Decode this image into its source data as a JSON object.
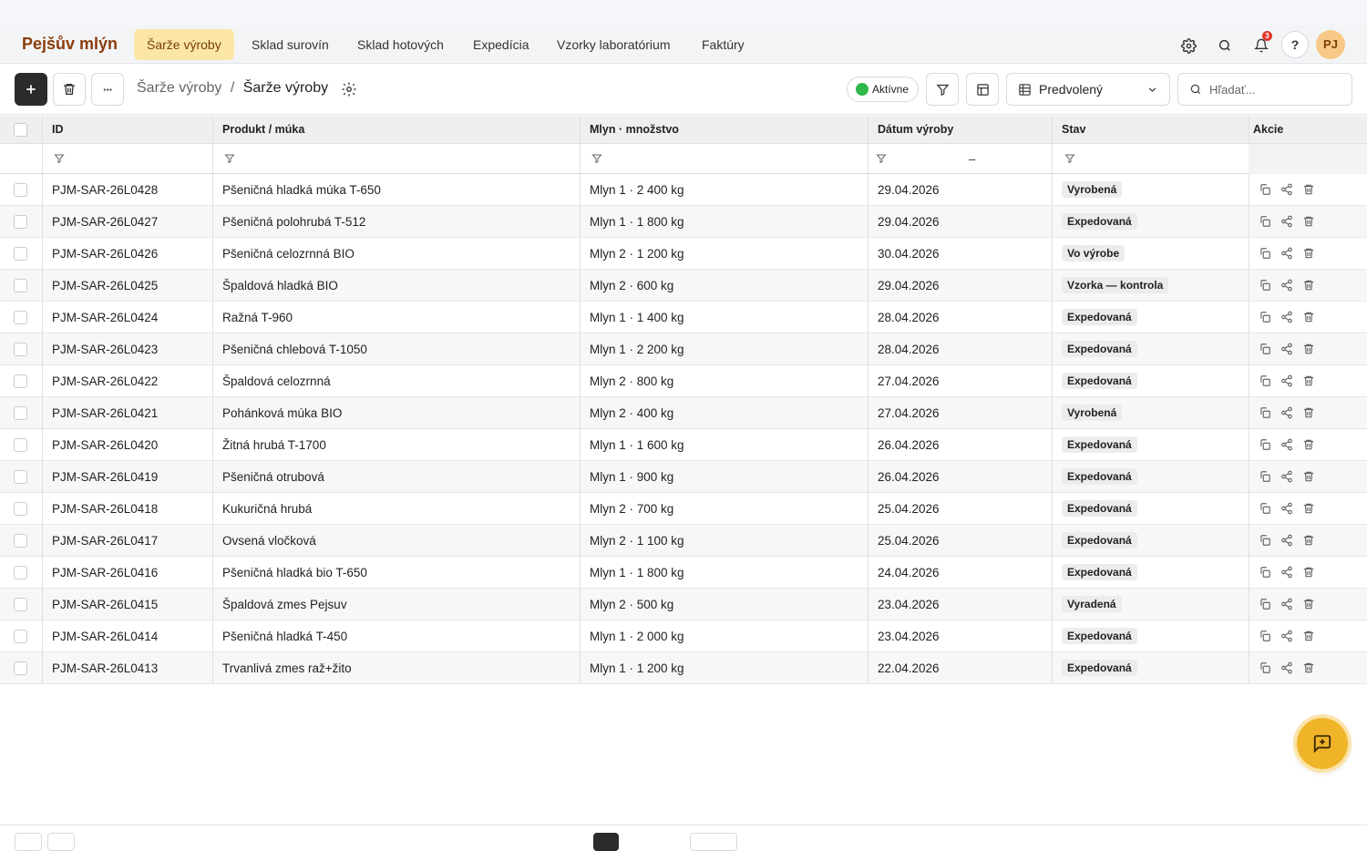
{
  "app": {
    "brand": "Pejšův mlýn"
  },
  "nav": {
    "tabs": [
      {
        "label": "Šarže výroby",
        "active": true
      },
      {
        "label": "Sklad surovín"
      },
      {
        "label": "Sklad hotových"
      },
      {
        "label": "Expedícia"
      },
      {
        "label": "Vzorky laboratórium"
      },
      {
        "label": "Faktúry"
      }
    ],
    "notifications_count": "3",
    "help_label": "?",
    "avatar_initials": "PJ"
  },
  "toolbar": {
    "add_label": "+",
    "more_label": "···",
    "breadcrumb_parent": "Šarže výroby",
    "breadcrumb_sep": "/",
    "breadcrumb_current": "Šarže výroby",
    "status_label": "Aktívne",
    "view_label": "Predvolený",
    "search_placeholder": "Hľadať..."
  },
  "table": {
    "headers": {
      "id": "ID",
      "product": "Produkt / múka",
      "mill": "Mlyn · množstvo",
      "date": "Dátum výroby",
      "status": "Stav",
      "actions": "Akcie"
    },
    "date_range_sep": "–",
    "rows": [
      {
        "id": "PJM-SAR-26L0428",
        "product": "Pšeničná hladká múka T-650",
        "mill": "Mlyn 1 · 2 400 kg",
        "date": "29.04.2026",
        "status": "Vyrobená"
      },
      {
        "id": "PJM-SAR-26L0427",
        "product": "Pšeničná polohrubá T-512",
        "mill": "Mlyn 1 · 1 800 kg",
        "date": "29.04.2026",
        "status": "Expedovaná"
      },
      {
        "id": "PJM-SAR-26L0426",
        "product": "Pšeničná celozrnná BIO",
        "mill": "Mlyn 2 · 1 200 kg",
        "date": "30.04.2026",
        "status": "Vo výrobe"
      },
      {
        "id": "PJM-SAR-26L0425",
        "product": "Špaldová hladká BIO",
        "mill": "Mlyn 2 · 600 kg",
        "date": "29.04.2026",
        "status": "Vzorka — kontrola"
      },
      {
        "id": "PJM-SAR-26L0424",
        "product": "Ražná T-960",
        "mill": "Mlyn 1 · 1 400 kg",
        "date": "28.04.2026",
        "status": "Expedovaná"
      },
      {
        "id": "PJM-SAR-26L0423",
        "product": "Pšeničná chlebová T-1050",
        "mill": "Mlyn 1 · 2 200 kg",
        "date": "28.04.2026",
        "status": "Expedovaná"
      },
      {
        "id": "PJM-SAR-26L0422",
        "product": "Špaldová celozrnná",
        "mill": "Mlyn 2 · 800 kg",
        "date": "27.04.2026",
        "status": "Expedovaná"
      },
      {
        "id": "PJM-SAR-26L0421",
        "product": "Pohánková múka BIO",
        "mill": "Mlyn 2 · 400 kg",
        "date": "27.04.2026",
        "status": "Vyrobená"
      },
      {
        "id": "PJM-SAR-26L0420",
        "product": "Žitná hrubá T-1700",
        "mill": "Mlyn 1 · 1 600 kg",
        "date": "26.04.2026",
        "status": "Expedovaná"
      },
      {
        "id": "PJM-SAR-26L0419",
        "product": "Pšeničná otrubová",
        "mill": "Mlyn 1 · 900 kg",
        "date": "26.04.2026",
        "status": "Expedovaná"
      },
      {
        "id": "PJM-SAR-26L0418",
        "product": "Kukuričná hrubá",
        "mill": "Mlyn 2 · 700 kg",
        "date": "25.04.2026",
        "status": "Expedovaná"
      },
      {
        "id": "PJM-SAR-26L0417",
        "product": "Ovsená vločková",
        "mill": "Mlyn 2 · 1 100 kg",
        "date": "25.04.2026",
        "status": "Expedovaná"
      },
      {
        "id": "PJM-SAR-26L0416",
        "product": "Pšeničná hladká bio T-650",
        "mill": "Mlyn 1 · 1 800 kg",
        "date": "24.04.2026",
        "status": "Expedovaná"
      },
      {
        "id": "PJM-SAR-26L0415",
        "product": "Špaldová zmes Pejsuv",
        "mill": "Mlyn 2 · 500 kg",
        "date": "23.04.2026",
        "status": "Vyradená"
      },
      {
        "id": "PJM-SAR-26L0414",
        "product": "Pšeničná hladká T-450",
        "mill": "Mlyn 1 · 2 000 kg",
        "date": "23.04.2026",
        "status": "Expedovaná"
      },
      {
        "id": "PJM-SAR-26L0413",
        "product": "Trvanlivá zmes raž+žito",
        "mill": "Mlyn 1 · 1 200 kg",
        "date": "22.04.2026",
        "status": "Expedovaná"
      }
    ]
  },
  "colors": {
    "brand": "#8a3b0c",
    "active_tab_bg": "#fbe6a8",
    "status_active": "#2fb84a",
    "fab": "#f0b429",
    "badge": "#e0362a"
  }
}
